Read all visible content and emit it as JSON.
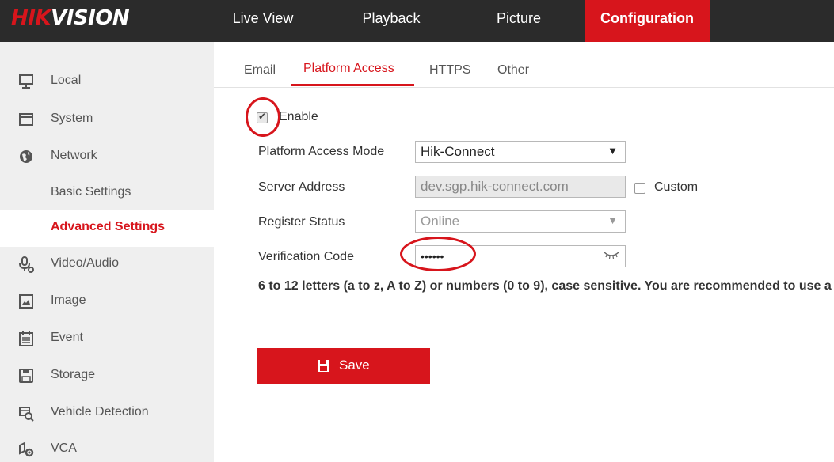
{
  "brand": {
    "logo_red": "HIK",
    "logo_white": "VISION"
  },
  "nav": [
    {
      "label": "Live View"
    },
    {
      "label": "Playback"
    },
    {
      "label": "Picture"
    },
    {
      "label": "Configuration",
      "active": true
    }
  ],
  "sidebar": {
    "items": [
      {
        "label": "Local",
        "icon": "monitor-icon"
      },
      {
        "label": "System",
        "icon": "system-icon"
      },
      {
        "label": "Network",
        "icon": "globe-icon"
      },
      {
        "label": "Basic Settings",
        "sub": true
      },
      {
        "label": "Advanced Settings",
        "sub": true,
        "selected": true
      },
      {
        "label": "Video/Audio",
        "icon": "microphone-icon"
      },
      {
        "label": "Image",
        "icon": "image-icon"
      },
      {
        "label": "Event",
        "icon": "calendar-icon"
      },
      {
        "label": "Storage",
        "icon": "floppy-icon"
      },
      {
        "label": "Vehicle Detection",
        "icon": "vehicle-search-icon"
      },
      {
        "label": "VCA",
        "icon": "vca-icon"
      }
    ]
  },
  "tabs": [
    {
      "label": "Email"
    },
    {
      "label": "Platform Access",
      "active": true
    },
    {
      "label": "HTTPS"
    },
    {
      "label": "Other"
    }
  ],
  "form": {
    "enable_label": "Enable",
    "enable_checked": true,
    "mode_label": "Platform Access Mode",
    "mode_value": "Hik-Connect",
    "server_label": "Server Address",
    "server_value": "dev.sgp.hik-connect.com",
    "custom_label": "Custom",
    "custom_checked": false,
    "status_label": "Register Status",
    "status_value": "Online",
    "code_label": "Verification Code",
    "code_value": "••••••",
    "hint": "6 to 12 letters (a to z, A to Z) or numbers (0 to 9), case sensitive. You are recommended to use a",
    "save_label": "Save"
  },
  "colors": {
    "accent": "#d7151c",
    "topbar": "#2b2b2b",
    "sidebar": "#efefef"
  }
}
